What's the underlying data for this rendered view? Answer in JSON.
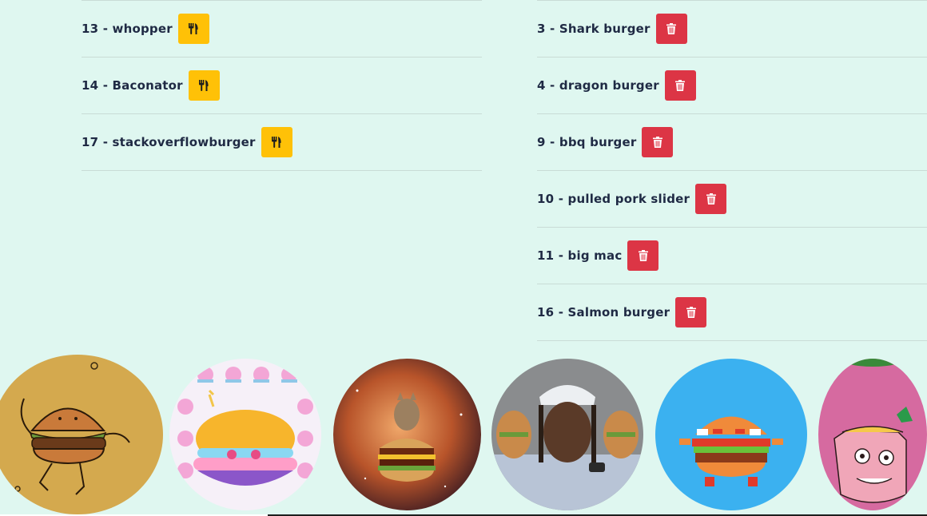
{
  "eaten": {
    "items": [
      {
        "label": "13 - whopper"
      },
      {
        "label": "14 - Baconator"
      },
      {
        "label": "17 - stackoverflowburger"
      }
    ]
  },
  "uneaten": {
    "items": [
      {
        "label": "3 - Shark burger"
      },
      {
        "label": "4 - dragon burger"
      },
      {
        "label": "9 - bbq burger"
      },
      {
        "label": "10 - pulled pork slider"
      },
      {
        "label": "11 - big mac"
      },
      {
        "label": "16 - Salmon burger"
      }
    ]
  },
  "icons": {
    "eat": "fork-knife-icon",
    "delete": "trash-icon"
  },
  "colors": {
    "background": "#dff7f0",
    "eat_button": "#ffc107",
    "delete_button": "#dc3545",
    "text": "#1f2a44"
  }
}
